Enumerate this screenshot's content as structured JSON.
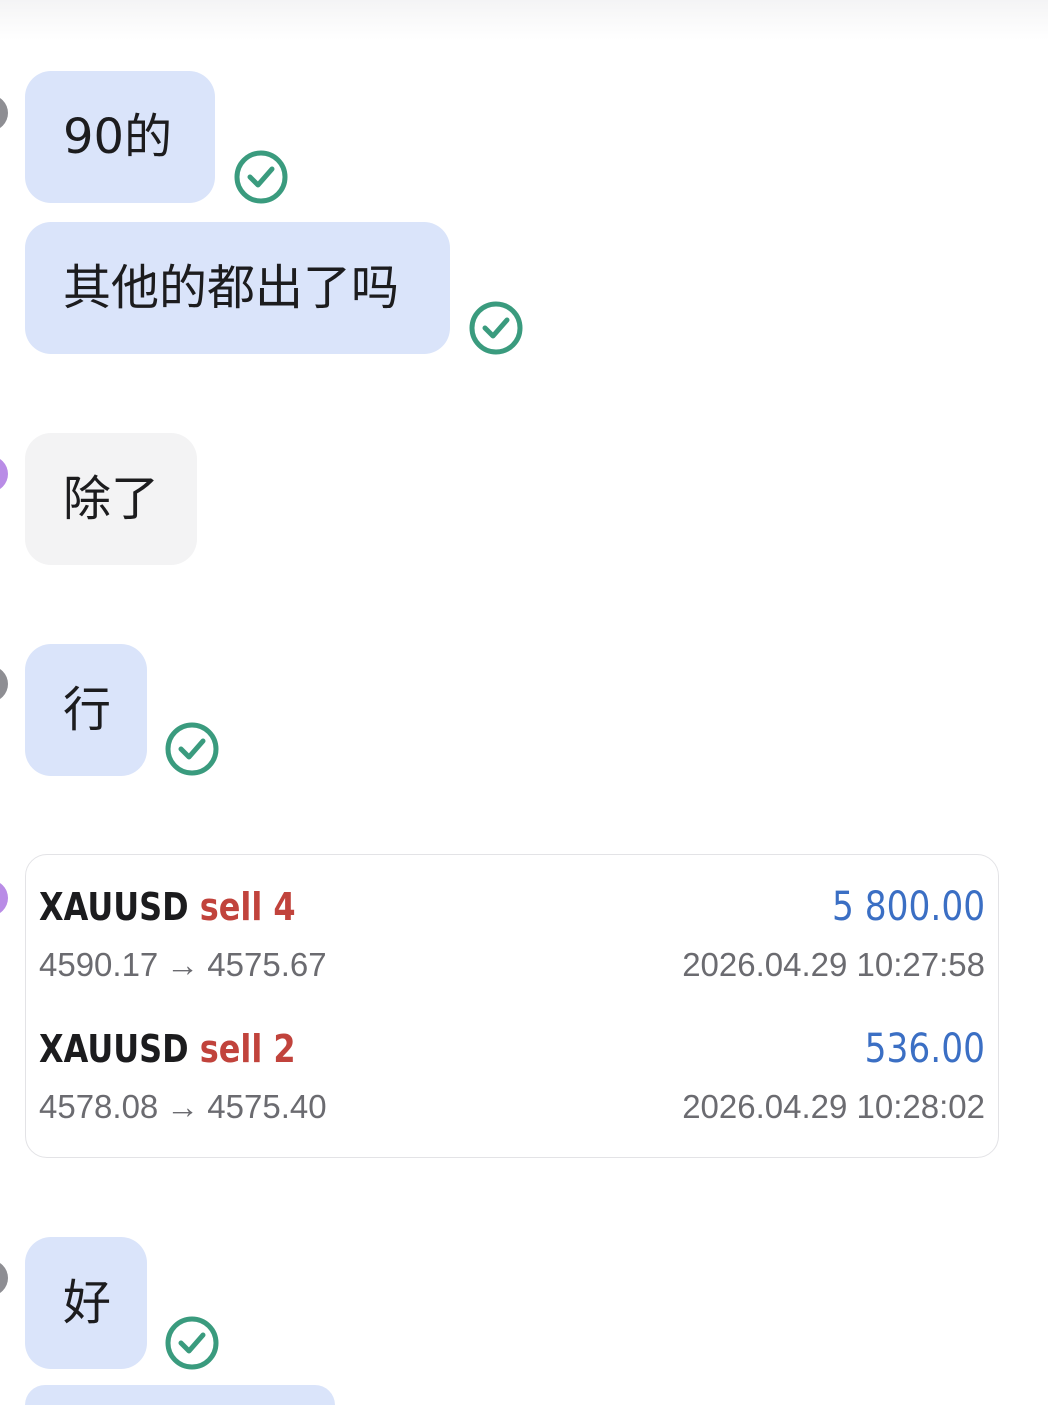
{
  "messages": [
    {
      "text": "90的",
      "direction": "outgoing",
      "status_icon": "check-circle-icon"
    },
    {
      "text": "其他的都出了吗",
      "direction": "outgoing",
      "status_icon": "check-circle-icon"
    },
    {
      "text": "除了",
      "direction": "incoming"
    },
    {
      "text": "行",
      "direction": "outgoing",
      "status_icon": "check-circle-icon"
    },
    {
      "text": "好",
      "direction": "outgoing",
      "status_icon": "check-circle-icon"
    }
  ],
  "trade_card": {
    "trades": [
      {
        "symbol": "XAUUSD",
        "side": "sell 4",
        "profit": "5 800.00",
        "open_price": "4590.17",
        "arrow": "→",
        "close_price": "4575.67",
        "time": "2026.04.29 10:27:58"
      },
      {
        "symbol": "XAUUSD",
        "side": "sell 2",
        "profit": "536.00",
        "open_price": "4578.08",
        "arrow": "→",
        "close_price": "4575.40",
        "time": "2026.04.29 10:28:02"
      }
    ]
  },
  "colors": {
    "outgoing_bubble": "#dae4fa",
    "incoming_bubble": "#f3f3f4",
    "read_check": "#3a9b7e",
    "sell_text": "#c1433c",
    "profit_text": "#3b6fc4"
  }
}
